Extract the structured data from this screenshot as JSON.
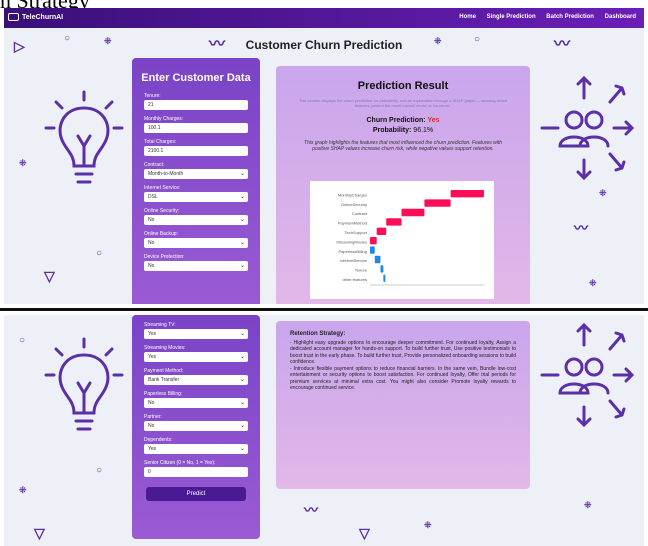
{
  "app": {
    "name": "TeleChurnAI"
  },
  "top_heading": "n Strategy",
  "nav": {
    "links": [
      "Home",
      "Single Prediction",
      "Batch Prediction",
      "Dashboard"
    ]
  },
  "page_title": "Customer Churn Prediction",
  "form": {
    "title": "Enter Customer Data",
    "fields_part1": [
      {
        "label": "Tenure:",
        "value": "21"
      },
      {
        "label": "Monthly Charges:",
        "value": "100.1"
      },
      {
        "label": "Total Charges:",
        "value": "2100.1"
      },
      {
        "label": "Contract:",
        "value": "Month-to-Month",
        "select": true
      },
      {
        "label": "Internet Service:",
        "value": "DSL",
        "select": true
      },
      {
        "label": "Online Security:",
        "value": "No",
        "select": true
      },
      {
        "label": "Online Backup:",
        "value": "No",
        "select": true
      },
      {
        "label": "Device Protection:",
        "value": "No",
        "select": true
      }
    ],
    "fields_part2": [
      {
        "label": "Streaming TV:",
        "value": "Yes",
        "select": true
      },
      {
        "label": "Streaming Movies:",
        "value": "Yes",
        "select": true
      },
      {
        "label": "Payment Method:",
        "value": "Bank Transfer",
        "select": true
      },
      {
        "label": "Paperless Billing:",
        "value": "No",
        "select": true
      },
      {
        "label": "Partner:",
        "value": "No",
        "select": true
      },
      {
        "label": "Dependents:",
        "value": "Yes",
        "select": true
      },
      {
        "label": "Senior Citizen (0 = No, 1 = Yes):",
        "value": "0"
      }
    ],
    "predict_label": "Predict"
  },
  "result": {
    "title": "Prediction Result",
    "note": "This section displays the churn prediction, its probability, and an explanation through a SHAP graph — showing which features pushed the result toward 'churn' or 'no churn'.",
    "churn_label": "Churn Prediction:",
    "churn_value": "Yes",
    "prob_label": "Probability:",
    "prob_value": "96.1%",
    "explanation": "This graph highlights the features that most influenced the churn prediction. Features with positive SHAP values increase churn risk, while negative values support retention."
  },
  "retention": {
    "title": "Retention Strategy:",
    "items": [
      "- Highlight easy upgrade options to encourage deeper commitment. For continued loyalty, Assign a dedicated account manager for hands-on support. To build further trust, Use positive testimonials to boost trust in the early phase. To build further trust, Provide personalized onboarding sessions to build confidence.",
      "- Introduce flexible payment options to reduce financial barriers. In the same vein, Bundle low-cost entertainment or security options to boost satisfaction. For continued loyalty, Offer trial periods for premium services at minimal extra cost. You might also consider Promote loyalty rewards to encourage continued service."
    ]
  },
  "chart_data": {
    "type": "bar",
    "categories": [
      "MonthlyCharges",
      "OnlineSecurity",
      "Contract",
      "PaymentMethod",
      "TechSupport",
      "StreamingMovies",
      "PaperlessBilling",
      "InternetService",
      "Tenure",
      "other features"
    ],
    "values": [
      0.7,
      0.55,
      0.48,
      0.32,
      0.2,
      0.14,
      -0.1,
      -0.12,
      -0.06,
      -0.02
    ],
    "colors": {
      "positive": "#ff0d57",
      "negative": "#1e88e5"
    },
    "xlabel": "",
    "ylabel": ""
  },
  "colors": {
    "nav": "#4a1a94",
    "form_card": "#8a4fcf",
    "result_card": "#d4aeeb",
    "accent_red": "#d32f2f"
  }
}
